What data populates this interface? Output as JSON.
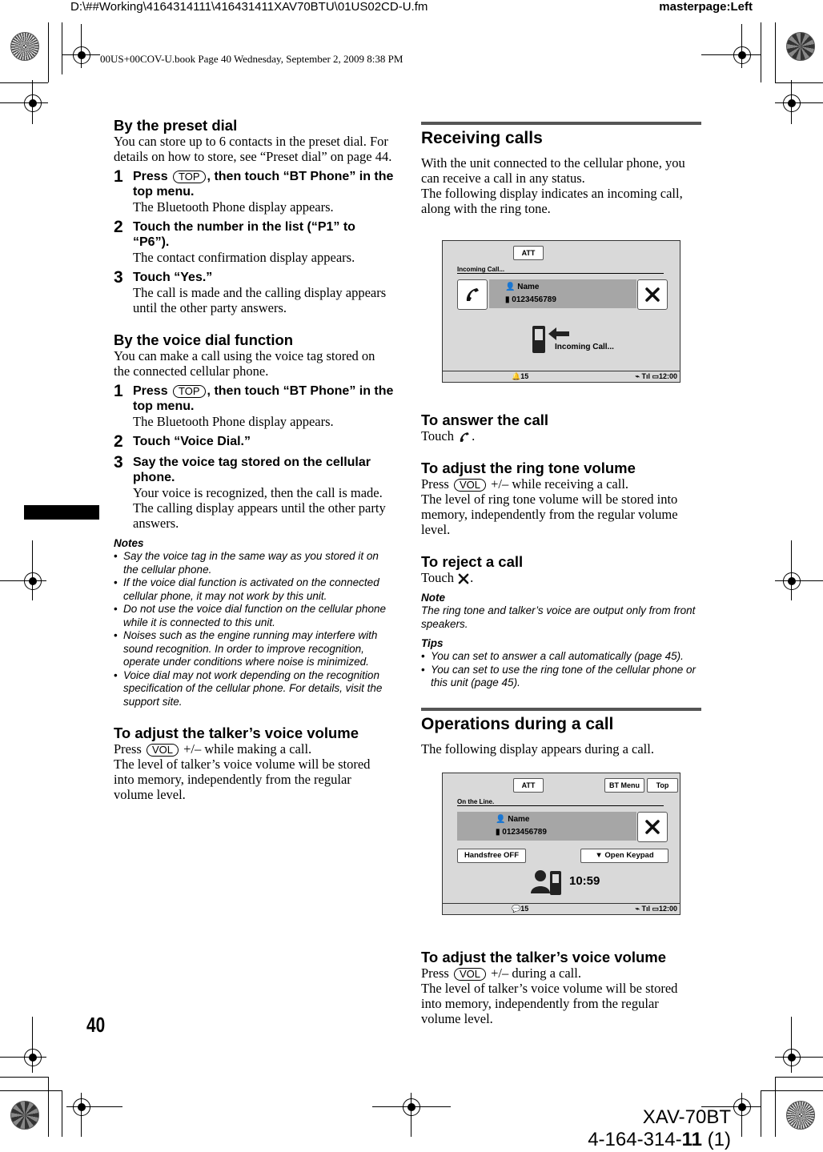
{
  "header": {
    "file_path": "D:\\##Working\\4164314111\\416431411XAV70BTU\\01US02CD-U.fm",
    "masterpage": "masterpage:Left",
    "book_line": "00US+00COV-U.book  Page 40  Wednesday, September 2, 2009  8:38 PM"
  },
  "left": {
    "preset": {
      "title": "By the preset dial",
      "intro": "You can store up to 6 contacts in the preset dial. For details on how to store, see “Preset dial” on page 44.",
      "steps": [
        {
          "num": "1",
          "title_pre": "Press",
          "key": "TOP",
          "title_post": ", then touch “BT Phone” in the top menu.",
          "desc": "The Bluetooth Phone display appears."
        },
        {
          "num": "2",
          "title": "Touch the number in the list (“P1” to “P6”).",
          "desc": "The contact confirmation display appears."
        },
        {
          "num": "3",
          "title": "Touch “Yes.”",
          "desc": "The call is made and the calling display appears until the other party answers."
        }
      ]
    },
    "voice": {
      "title": "By the voice dial function",
      "intro": "You can make a call using the voice tag stored on the connected cellular phone.",
      "steps": [
        {
          "num": "1",
          "title_pre": "Press",
          "key": "TOP",
          "title_post": ", then touch “BT Phone” in the top menu.",
          "desc": "The Bluetooth Phone display appears."
        },
        {
          "num": "2",
          "title": "Touch “Voice Dial.”"
        },
        {
          "num": "3",
          "title": "Say the voice tag stored on the cellular phone.",
          "desc1": "Your voice is recognized, then the call is made.",
          "desc2": "The calling display appears until the other party answers."
        }
      ],
      "notes_title": "Notes",
      "notes": [
        "Say the voice tag in the same way as you stored it on the cellular phone.",
        "If the voice dial function is activated on the connected cellular phone, it may not work by this unit.",
        "Do not use the voice dial function on the cellular phone while it is connected to this unit.",
        "Noises such as the engine running may interfere with sound recognition. In order to improve recognition, operate under conditions where noise is minimized.",
        "Voice dial may not work depending on the recognition specification of the cellular phone. For details, visit the support site."
      ]
    },
    "talker": {
      "title": "To adjust the talker’s voice volume",
      "press": "Press",
      "key": "VOL",
      "press_post": "+/– while making a call.",
      "desc": "The level of talker’s voice volume will be stored into memory, independently from the regular volume level."
    }
  },
  "right": {
    "receiving": {
      "title": "Receiving calls",
      "intro1": "With the unit connected to the cellular phone, you can receive a call in any status.",
      "intro2": "The following display indicates an incoming call, along with the ring tone."
    },
    "incoming_screen": {
      "att_label": "ATT",
      "status": "Incoming Call...",
      "name": "Name",
      "number": "0123456789",
      "center_label": "Incoming Call...",
      "bar_left": "15",
      "bar_time": "12:00"
    },
    "answer": {
      "title": "To answer the call",
      "text": "Touch",
      "suffix": "."
    },
    "ring": {
      "title": "To adjust the ring tone volume",
      "press": "Press",
      "key": "VOL",
      "press_post": "+/– while receiving a call.",
      "desc": "The level of ring tone volume will be stored into memory, independently from the regular volume level."
    },
    "reject": {
      "title": "To reject a call",
      "text": "Touch",
      "suffix": "."
    },
    "note": {
      "title": "Note",
      "text": "The ring tone and talker’s voice are output only from front speakers."
    },
    "tips": {
      "title": "Tips",
      "items": [
        "You can set to answer a call automatically (page 45).",
        "You can set to use the ring tone of the cellular phone or this unit (page 45)."
      ]
    },
    "operations": {
      "title": "Operations during a call",
      "intro": "The following display appears during a call."
    },
    "call_screen": {
      "att_label": "ATT",
      "bt_menu_label": "BT Menu",
      "top_label": "Top",
      "status": "On the Line.",
      "name": "Name",
      "number": "0123456789",
      "handsfree_label": "Handsfree OFF",
      "keypad_label": "▼ Open Keypad",
      "call_timer": "10:59",
      "bar_left": "15",
      "bar_time": "12:00"
    },
    "talker": {
      "title": "To adjust the talker’s voice volume",
      "press": "Press",
      "key": "VOL",
      "press_post": "+/– during a call.",
      "desc": "The level of talker’s voice volume will be stored into memory, independently from the regular volume level."
    }
  },
  "footer": {
    "page_number": "40",
    "model": "XAV-70BT",
    "part_number_pre": "4-164-314-",
    "part_number_bold": "11",
    "part_number_post": " (1)"
  }
}
